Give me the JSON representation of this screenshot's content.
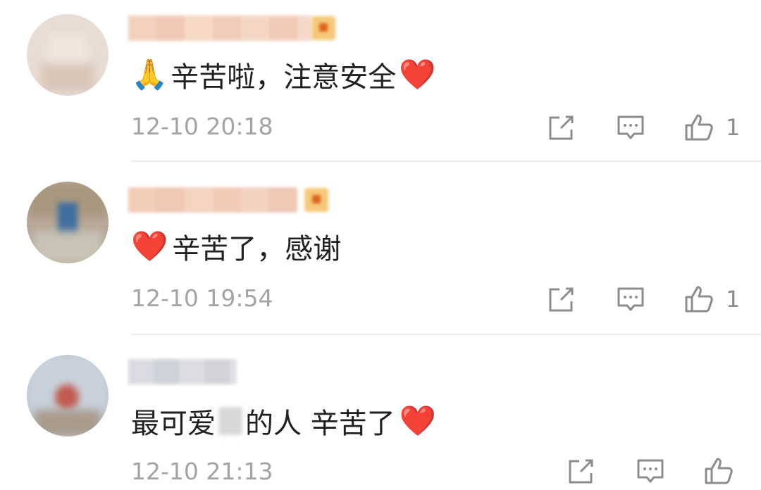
{
  "comments": [
    {
      "text": "辛苦啦，注意安全",
      "prefix_emoji": "🙏",
      "suffix_emoji": "❤️",
      "time": "12-10 20:18",
      "likes": "1"
    },
    {
      "text": "辛苦了，感谢",
      "prefix_emoji": "❤️",
      "suffix_emoji": "",
      "time": "12-10 19:54",
      "likes": "1"
    },
    {
      "text_before": "最可爱",
      "text_after": "的人 辛苦了",
      "suffix_emoji": "❤️",
      "time": "12-10 21:13",
      "likes": ""
    }
  ],
  "colors": {
    "text": "#202020",
    "meta": "#a4a4a4",
    "icon": "#8c8c8c",
    "divider": "#ececec"
  },
  "icons": [
    "share-icon",
    "reply-icon",
    "like-icon"
  ]
}
